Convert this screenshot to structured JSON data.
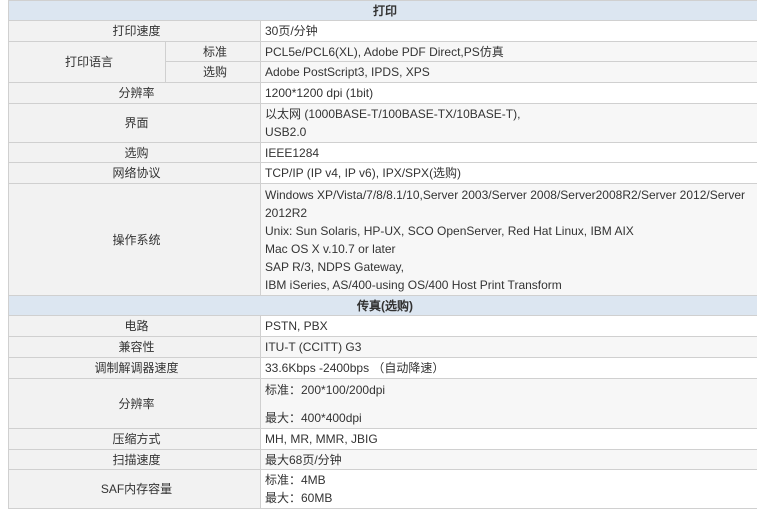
{
  "sections": {
    "print": "打印",
    "fax": "传真(选购)"
  },
  "print": {
    "speed": {
      "label": "打印速度",
      "value": "30页/分钟"
    },
    "lang": {
      "label": "打印语言",
      "std_label": "标准",
      "std_value": "PCL5e/PCL6(XL), Adobe PDF Direct,PS仿真",
      "opt_label": "选购",
      "opt_value": "Adobe PostScript3, IPDS, XPS"
    },
    "resolution": {
      "label": "分辨率",
      "value": "1200*1200 dpi (1bit)"
    },
    "interface": {
      "label": "界面",
      "lines": [
        "以太网 (1000BASE-T/100BASE-TX/10BASE-T),",
        "USB2.0"
      ]
    },
    "option": {
      "label": "选购",
      "value": "IEEE1284"
    },
    "protocol": {
      "label": "网络协议",
      "value": "TCP/IP (IP v4, IP v6), IPX/SPX(选购)"
    },
    "os": {
      "label": "操作系统",
      "lines": [
        "Windows XP/Vista/7/8/8.1/10,Server 2003/Server 2008/Server2008R2/Server 2012/Server",
        "2012R2",
        "Unix: Sun Solaris, HP-UX, SCO OpenServer, Red Hat Linux, IBM AIX",
        "Mac OS X v.10.7 or later",
        "SAP R/3, NDPS Gateway,",
        "IBM iSeries, AS/400-using OS/400 Host Print Transform"
      ]
    }
  },
  "fax": {
    "circuit": {
      "label": "电路",
      "value": "PSTN, PBX"
    },
    "compat": {
      "label": "兼容性",
      "value": "ITU-T (CCITT) G3"
    },
    "modem": {
      "label": "调制解调器速度",
      "value": "33.6Kbps -2400bps （自动降速）"
    },
    "resolution": {
      "label": "分辨率",
      "std": "标准：200*100/200dpi",
      "max": "最大：400*400dpi"
    },
    "compression": {
      "label": "压缩方式",
      "value": "MH, MR, MMR, JBIG"
    },
    "scan": {
      "label": "扫描速度",
      "value": "最大68页/分钟"
    },
    "memory": {
      "label": "SAF内存容量",
      "std": "标准：4MB",
      "max": "最大：60MB"
    }
  }
}
